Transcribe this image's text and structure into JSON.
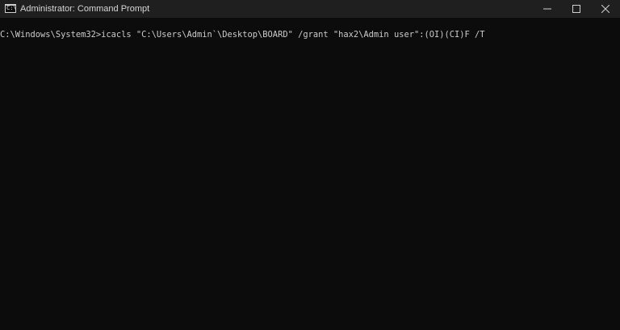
{
  "window": {
    "title": "Administrator: Command Prompt",
    "app_icon_glyph": "C:\\",
    "controls": {
      "minimize": "minimize-icon",
      "maximize": "maximize-icon",
      "close": "close-icon"
    },
    "colors": {
      "titlebar": "#1f1f1f",
      "console_bg": "#0c0c0c",
      "console_fg": "#cccccc"
    }
  },
  "console": {
    "lines": [
      "C:\\Windows\\System32>icacls \"C:\\Users\\Admin`\\Desktop\\BOARD\" /grant \"hax2\\Admin user\":(OI)(CI)F /T"
    ]
  }
}
